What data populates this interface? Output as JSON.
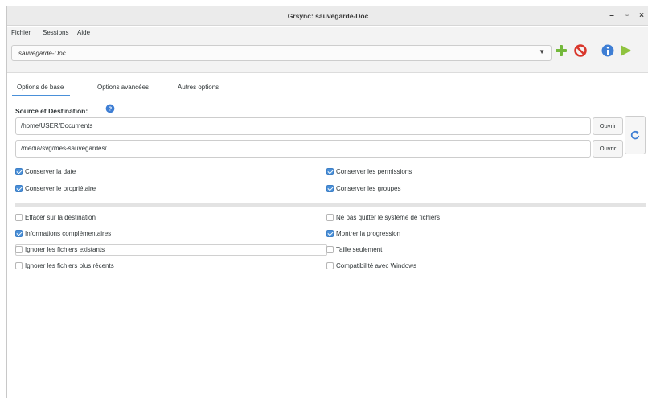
{
  "window": {
    "title": "Grsync: sauvegarde-Doc",
    "minimize_glyph": "–",
    "maximize_glyph": "▫",
    "close_glyph": "×"
  },
  "menu": {
    "items": [
      "Fichier",
      "Sessions",
      "Aide"
    ]
  },
  "session": {
    "value": "sauvegarde-Doc",
    "icons": [
      "add-session-icon",
      "delete-session-icon",
      "info-icon",
      "run-icon"
    ]
  },
  "tabs": {
    "items": [
      "Options de base",
      "Options avancées",
      "Autres options"
    ],
    "active": "Options de base"
  },
  "source_dest": {
    "title": "Source et Destination:",
    "source": "/home/USER/Documents",
    "destination": "/media/svg/mes-sauvegardes/",
    "open_label": "Ouvrir"
  },
  "options": {
    "preserve_date": {
      "label": "Conserver la date",
      "checked": true
    },
    "preserve_permissions": {
      "label": "Conserver les permissions",
      "checked": true
    },
    "preserve_owner": {
      "label": "Conserver le propriétaire",
      "checked": true
    },
    "preserve_groups": {
      "label": "Conserver les groupes",
      "checked": true
    },
    "delete_destination": {
      "label": "Effacer sur la destination",
      "checked": false
    },
    "one_filesystem": {
      "label": "Ne pas quitter le système de fichiers",
      "checked": false
    },
    "verbose": {
      "label": "Informations complémentaires",
      "checked": true
    },
    "show_progress": {
      "label": "Montrer la progression",
      "checked": true
    },
    "ignore_existing": {
      "label": "Ignorer les fichiers existants",
      "checked": false
    },
    "size_only": {
      "label": "Taille seulement",
      "checked": false
    },
    "skip_newer": {
      "label": "Ignorer les fichiers plus récents",
      "checked": false
    },
    "windows_compat": {
      "label": "Compatibilité avec Windows",
      "checked": false
    }
  },
  "colors": {
    "accent": "#4a90d9",
    "add_green": "#73b83b",
    "stop_red": "#d9362b",
    "run_green": "#8fc33f"
  }
}
